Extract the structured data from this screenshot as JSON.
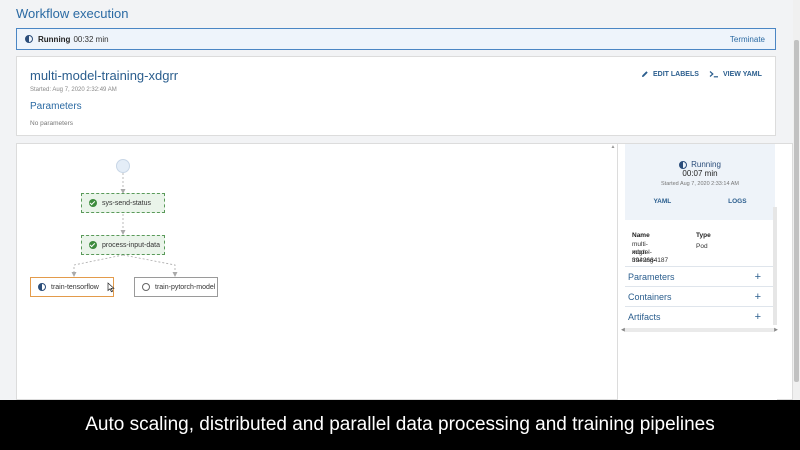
{
  "page": {
    "title": "Workflow execution"
  },
  "status_bar": {
    "label": "Running",
    "time": "00:32 min",
    "terminate_label": "Terminate"
  },
  "workflow": {
    "name": "multi-model-training-xdgrr",
    "started": "Started: Aug 7, 2020 2:32:49 AM",
    "edit_labels": "EDIT LABELS",
    "view_yaml": "VIEW YAML",
    "parameters_title": "Parameters",
    "no_parameters": "No parameters"
  },
  "graph": {
    "nodes": [
      {
        "name": "sys-send-status",
        "status": "succeeded"
      },
      {
        "name": "process-input-data",
        "status": "succeeded"
      },
      {
        "name": "train-tensorflow",
        "status": "running"
      },
      {
        "name": "train-pytorch-model",
        "status": "pending"
      }
    ]
  },
  "side_panel": {
    "status": "Running",
    "time": "00:07 min",
    "started": "Started Aug 7, 2020 2:33:14 AM",
    "tabs": [
      "YAML",
      "LOGS"
    ],
    "table": {
      "headers": [
        "Name",
        "Type"
      ],
      "name_lines": [
        "multi-model-training-",
        "xdgrr-3942684187"
      ],
      "type": "Pod"
    },
    "sections": [
      "Parameters",
      "Containers",
      "Artifacts"
    ],
    "plus_symbol": "+"
  },
  "caption": "Auto scaling, distributed and parallel data processing and training pipelines",
  "colors": {
    "accent": "#2b6aa3",
    "success": "#3d8b3d",
    "running_border": "#e39b4b",
    "status_bar_bg": "#eef4fb"
  }
}
